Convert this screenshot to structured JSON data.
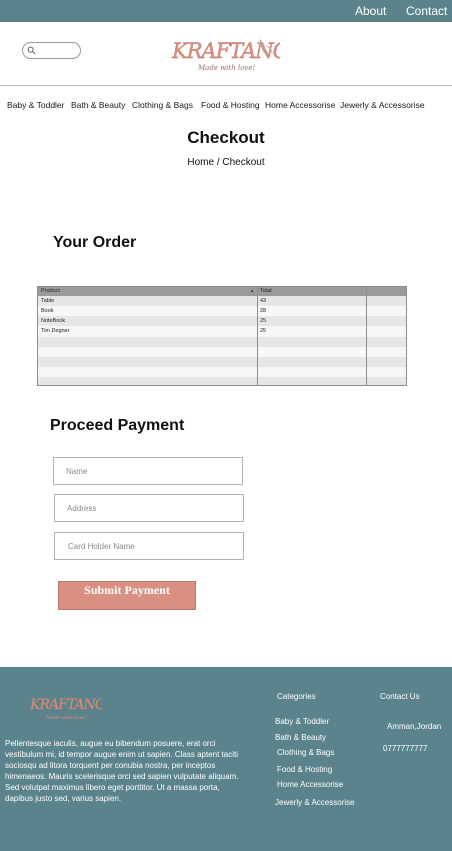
{
  "topbar": {
    "about": "About",
    "contact": "Contact"
  },
  "header": {
    "search_placeholder": "",
    "logo_text": "KRAFTANGLE",
    "logo_tagline": "Made with love!"
  },
  "nav": {
    "items": [
      {
        "label": "Baby & Toddler"
      },
      {
        "label": "Bath & Beauty"
      },
      {
        "label": "Clothing & Bags"
      },
      {
        "label": "Food & Hosting"
      },
      {
        "label": "Home Accessorise"
      },
      {
        "label": "Jewerly & Accessorise"
      }
    ]
  },
  "page": {
    "title": "Checkout",
    "breadcrumb": "Home / Checkout"
  },
  "order": {
    "heading": "Your Order",
    "columns": [
      "Product",
      "Total"
    ],
    "rows": [
      {
        "product": "Table",
        "total": "43"
      },
      {
        "product": "Book",
        "total": "28"
      },
      {
        "product": "NoteBook",
        "total": "25"
      },
      {
        "product": "Tim Degner",
        "total": "25"
      }
    ]
  },
  "payment": {
    "heading": "Proceed Payment",
    "name_placeholder": "Name",
    "address_placeholder": "Address",
    "card_placeholder": "Card Holder Name",
    "submit_label": "Submit Payment"
  },
  "footer": {
    "logo_text": "KRAFTANGLE",
    "logo_tagline": "Made with love!",
    "description": "Pellentesque iaculis, augue eu bibendum posuere, erat orci vestibulum mi, id tempor augue enim ut sapien. Class aptent taciti sociosqu ad litora torquent per conubia nostra, per inceptos himenaeos. Mauris scelerisque orci sed sapien vulputate aliquam. Sed volutpat maximus libero eget porttitor. Ut a massa porta, dapibus justo sed, varius sapien.",
    "categories_heading": "Categories",
    "categories": [
      "Baby & Toddler",
      "Bath & Beauty",
      "Clothing & Bags",
      "Food & Hosting",
      "Home Accessorise",
      "Jewerly & Accessorise"
    ],
    "contact_heading": "Contact Us",
    "location": "Amman,Jordan",
    "phone": "0777777777"
  },
  "colors": {
    "topbar": "#5a838c",
    "footer": "#5a838c",
    "submit": "#d99080",
    "logo": "#d99080"
  }
}
